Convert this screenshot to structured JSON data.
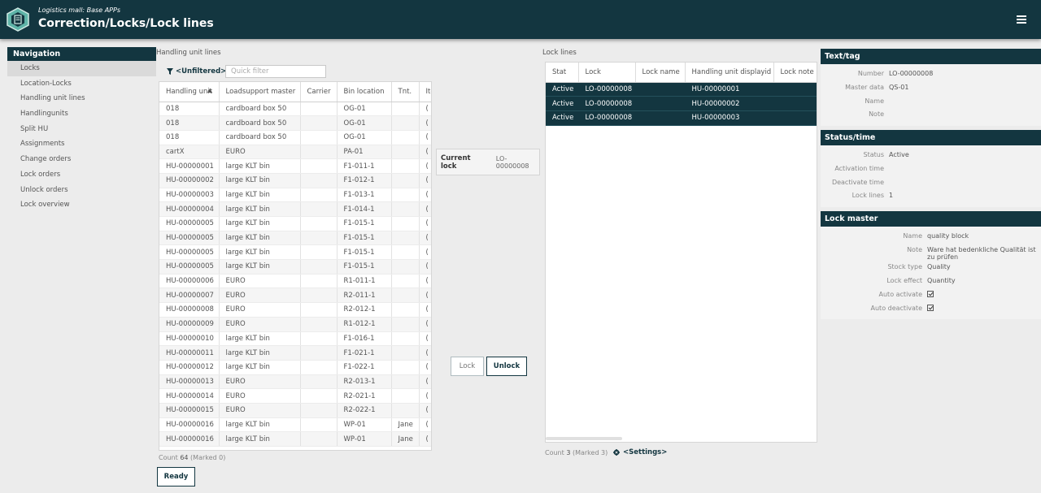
{
  "header": {
    "app_subtitle": "Logistics mall: Base APPs",
    "title": "Correction/Locks/Lock lines",
    "logo_icon": "cube-hexagon-icon",
    "menu_icon": "hamburger-menu-icon",
    "background_color": "#133640"
  },
  "nav": {
    "title": "Navigation",
    "items": [
      {
        "label": "Locks",
        "active": true
      },
      {
        "label": "Location-Locks"
      },
      {
        "label": "Handling unit lines"
      },
      {
        "label": "Handlingunits"
      },
      {
        "label": "Split HU"
      },
      {
        "label": "Assignments"
      },
      {
        "label": "Change orders"
      },
      {
        "label": "Lock orders"
      },
      {
        "label": "Unlock orders"
      },
      {
        "label": "Lock overview"
      }
    ]
  },
  "hu_panel": {
    "section_label": "Handling unit lines",
    "filter_label": "<Unfiltered>",
    "filter_icon": "filter-icon",
    "quick_filter_placeholder": "Quick filter",
    "columns": [
      "Handling unit",
      "Loadsupport master",
      "Carrier",
      "Bin location",
      "Tnt.",
      "Ite"
    ],
    "sorted_column_icon": "sort-ascending-icon",
    "rows": [
      [
        "018",
        "cardboard box 50",
        "",
        "OG-01",
        "",
        "("
      ],
      [
        "018",
        "cardboard box 50",
        "",
        "OG-01",
        "",
        "("
      ],
      [
        "018",
        "cardboard box 50",
        "",
        "OG-01",
        "",
        "("
      ],
      [
        "cartX",
        "EURO",
        "",
        "PA-01",
        "",
        "("
      ],
      [
        "HU-00000001",
        "large KLT bin",
        "",
        "F1-011-1",
        "",
        "("
      ],
      [
        "HU-00000002",
        "large KLT bin",
        "",
        "F1-012-1",
        "",
        "("
      ],
      [
        "HU-00000003",
        "large KLT bin",
        "",
        "F1-013-1",
        "",
        "("
      ],
      [
        "HU-00000004",
        "large KLT bin",
        "",
        "F1-014-1",
        "",
        "("
      ],
      [
        "HU-00000005",
        "large KLT bin",
        "",
        "F1-015-1",
        "",
        "("
      ],
      [
        "HU-00000005",
        "large KLT bin",
        "",
        "F1-015-1",
        "",
        "("
      ],
      [
        "HU-00000005",
        "large KLT bin",
        "",
        "F1-015-1",
        "",
        "("
      ],
      [
        "HU-00000005",
        "large KLT bin",
        "",
        "F1-015-1",
        "",
        "("
      ],
      [
        "HU-00000006",
        "EURO",
        "",
        "R1-011-1",
        "",
        "("
      ],
      [
        "HU-00000007",
        "EURO",
        "",
        "R2-011-1",
        "",
        "("
      ],
      [
        "HU-00000008",
        "EURO",
        "",
        "R2-012-1",
        "",
        "("
      ],
      [
        "HU-00000009",
        "EURO",
        "",
        "R1-012-1",
        "",
        "("
      ],
      [
        "HU-00000010",
        "large KLT bin",
        "",
        "F1-016-1",
        "",
        "("
      ],
      [
        "HU-00000011",
        "large KLT bin",
        "",
        "F1-021-1",
        "",
        "("
      ],
      [
        "HU-00000012",
        "large KLT bin",
        "",
        "F1-022-1",
        "",
        "("
      ],
      [
        "HU-00000013",
        "EURO",
        "",
        "R2-013-1",
        "",
        "("
      ],
      [
        "HU-00000014",
        "EURO",
        "",
        "R2-021-1",
        "",
        "("
      ],
      [
        "HU-00000015",
        "EURO",
        "",
        "R2-022-1",
        "",
        "("
      ],
      [
        "HU-00000016",
        "large KLT bin",
        "",
        "WP-01",
        "Jane",
        "("
      ],
      [
        "HU-00000016",
        "large KLT bin",
        "",
        "WP-01",
        "Jane",
        "("
      ]
    ],
    "count_prefix": "Count",
    "count_value": "64",
    "count_suffix": "(Marked 0)"
  },
  "middle": {
    "current_lock_label": "Current lock",
    "current_lock_value": "LO-00000008",
    "lock_button": "Lock",
    "unlock_button": "Unlock"
  },
  "lock_panel": {
    "section_label": "Lock lines",
    "columns": [
      "Stat",
      "Lock",
      "Lock name",
      "Handling unit displayid",
      "Lock note"
    ],
    "rows": [
      [
        "Active",
        "LO-00000008",
        "",
        "HU-00000001",
        ""
      ],
      [
        "Active",
        "LO-00000008",
        "",
        "HU-00000002",
        ""
      ],
      [
        "Active",
        "LO-00000008",
        "",
        "HU-00000003",
        ""
      ]
    ],
    "count_prefix": "Count",
    "count_value": "3",
    "count_suffix": "(Marked 3)",
    "settings_label": "<Settings>",
    "settings_icon": "gear-icon",
    "selected_row_color": "#133640"
  },
  "text_tag": {
    "title": "Text/tag",
    "fields": [
      {
        "key": "Number",
        "value": "LO-00000008"
      },
      {
        "key": "Master data",
        "value": "QS-01"
      },
      {
        "key": "Name",
        "value": ""
      },
      {
        "key": "Note",
        "value": ""
      }
    ]
  },
  "status_time": {
    "title": "Status/time",
    "fields": [
      {
        "key": "Status",
        "value": "Active"
      },
      {
        "key": "Activation time",
        "value": ""
      },
      {
        "key": "Deactivate time",
        "value": ""
      },
      {
        "key": "Lock lines",
        "value": "1"
      }
    ]
  },
  "lock_master": {
    "title": "Lock master",
    "fields": [
      {
        "key": "Name",
        "value": "quality block"
      },
      {
        "key": "Note",
        "value": "Ware hat bedenkliche Qualität ist zu prüfen"
      },
      {
        "key": "Stock type",
        "value": "Quality"
      },
      {
        "key": "Lock effect",
        "value": "Quantity"
      }
    ],
    "checks": [
      {
        "key": "Auto activate",
        "checked": true
      },
      {
        "key": "Auto deactivate",
        "checked": true
      }
    ]
  },
  "ready_button": "Ready"
}
